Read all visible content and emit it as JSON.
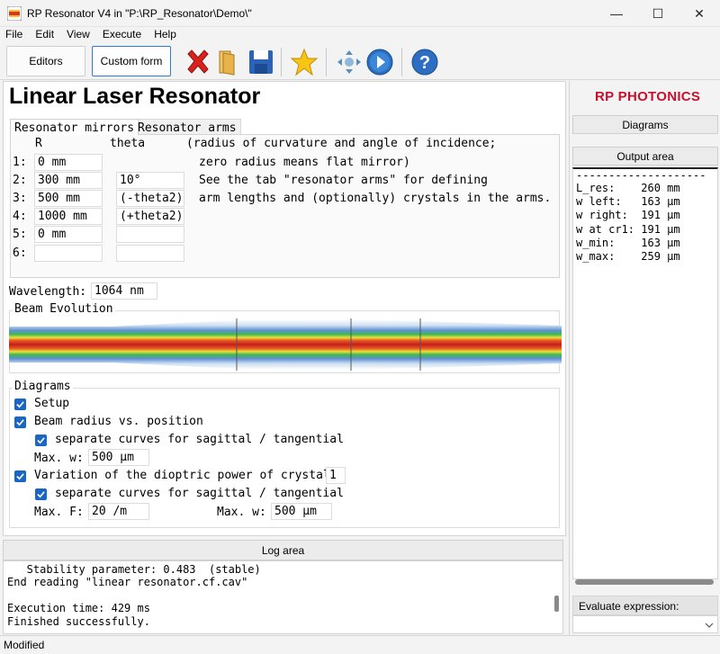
{
  "window": {
    "title": "RP Resonator V4 in \"P:\\RP_Resonator\\Demo\\\"",
    "minimize": "—",
    "maximize": "☐",
    "close": "✕"
  },
  "menu": [
    "File",
    "Edit",
    "View",
    "Execute",
    "Help"
  ],
  "toolbar": {
    "editors_label": "Editors",
    "custom_form_label": "Custom form",
    "icons": [
      "close-red-x-icon",
      "open-folder-icon",
      "save-disk-icon",
      "favorite-star-icon",
      "move-arrows-icon",
      "run-play-icon",
      "help-question-icon"
    ]
  },
  "main": {
    "title": "Linear Laser Resonator",
    "tabs": [
      "Resonator mirrors",
      "Resonator arms"
    ],
    "mirrors": {
      "header_r": "R",
      "header_theta": "theta",
      "row_numbers": [
        "1:",
        "2:",
        "3:",
        "4:",
        "5:",
        "6:"
      ],
      "r_values": [
        "0 mm",
        "300 mm",
        "500 mm",
        "1000 mm",
        "0 mm",
        ""
      ],
      "theta_values": [
        "",
        "10°",
        "(-theta2)",
        "(+theta2)",
        "",
        ""
      ],
      "notes": [
        "(radius of curvature and angle of incidence;",
        "zero radius means flat mirror)",
        "See the tab \"resonator arms\" for defining",
        "arm lengths and (optionally) crystals in the arms."
      ]
    },
    "wavelength_label": "Wavelength:",
    "wavelength_value": "1064 nm",
    "beam_evolution_title": "Beam Evolution",
    "diagrams": {
      "title": "Diagrams",
      "setup": "Setup",
      "beam_radius": "Beam radius vs. position",
      "separate1": "separate curves for sagittal / tangential",
      "max_w_label": "Max. w:",
      "max_w_value": "500 µm",
      "variation": "Variation of the dioptric power of crystal",
      "crystal_value": "1",
      "separate2": "separate curves for sagittal / tangential",
      "max_f_label": "Max. F:",
      "max_f_value": "20 /m",
      "max_w2_label": "Max. w:",
      "max_w2_value": "500 µm"
    }
  },
  "log": {
    "header": "Log area",
    "lines": "   Stability parameter: 0.483  (stable)\nEnd reading \"linear resonator.cf.cav\"\n\nExecution time: 429 ms\nFinished successfully."
  },
  "right": {
    "logo": "RP PHOTONICS",
    "diagrams_btn": "Diagrams",
    "output_btn": "Output area",
    "output_dashes": "--------------------",
    "output": "L_res:    260 mm\nw left:   163 µm\nw right:  191 µm\nw at cr1: 191 µm\nw_min:    163 µm\nw_max:    259 µm",
    "evaluate_label": "Evaluate expression:"
  },
  "status": "Modified",
  "colors": {
    "checkbox": "#1a66c6",
    "logo_red": "#c8102e",
    "beam_center": "#c41e1e"
  }
}
